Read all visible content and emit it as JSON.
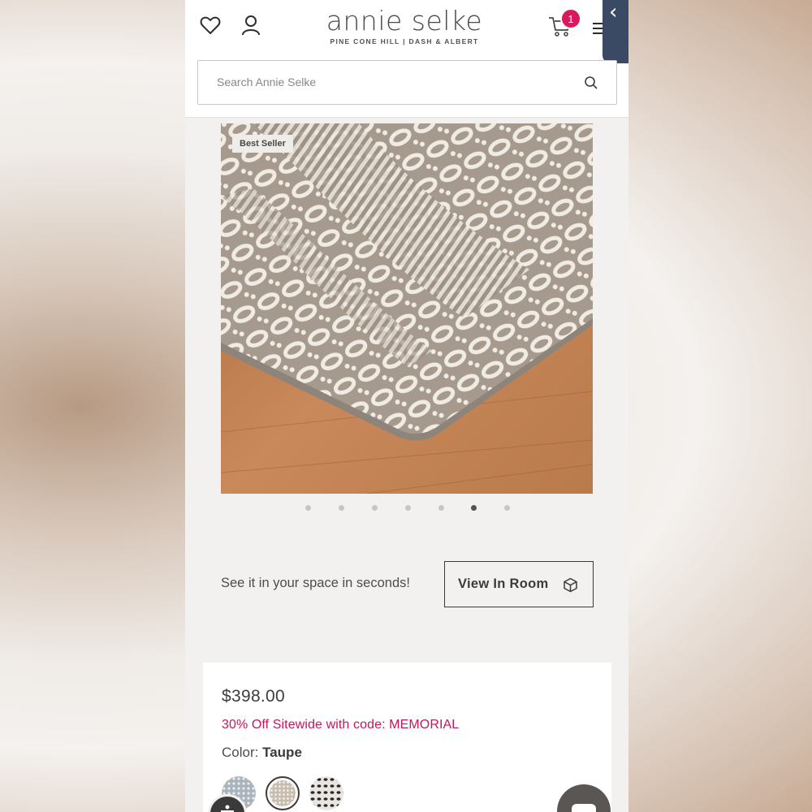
{
  "header": {
    "logo_main": "annie selke",
    "logo_sub": "PINE CONE HILL | DASH & ALBERT",
    "cart_count": "1",
    "side_tab_glyph": "‹"
  },
  "search": {
    "placeholder": "Search Annie Selke"
  },
  "gallery": {
    "badge": "Best Seller",
    "dot_count": 7,
    "active_dot": 6
  },
  "ar": {
    "prompt": "See it in your space in seconds!",
    "button_label": "View In Room"
  },
  "product": {
    "price": "$398.00",
    "promo": "30% Off Sitewide with code: MEMORIAL",
    "color_label": "Color:",
    "color_value": "Taupe",
    "swatches": [
      "blue-gray",
      "taupe",
      "black-white"
    ],
    "selected_swatch": 1
  },
  "colors": {
    "brand_pink": "#d9195d",
    "promo": "#c1185a",
    "side_tab": "#3b4a64",
    "text_dark": "#3d3b39"
  },
  "icons": [
    "heart-icon",
    "user-icon",
    "cart-icon",
    "menu-icon",
    "search-icon",
    "cube-icon",
    "accessibility-icon",
    "chat-icon"
  ]
}
